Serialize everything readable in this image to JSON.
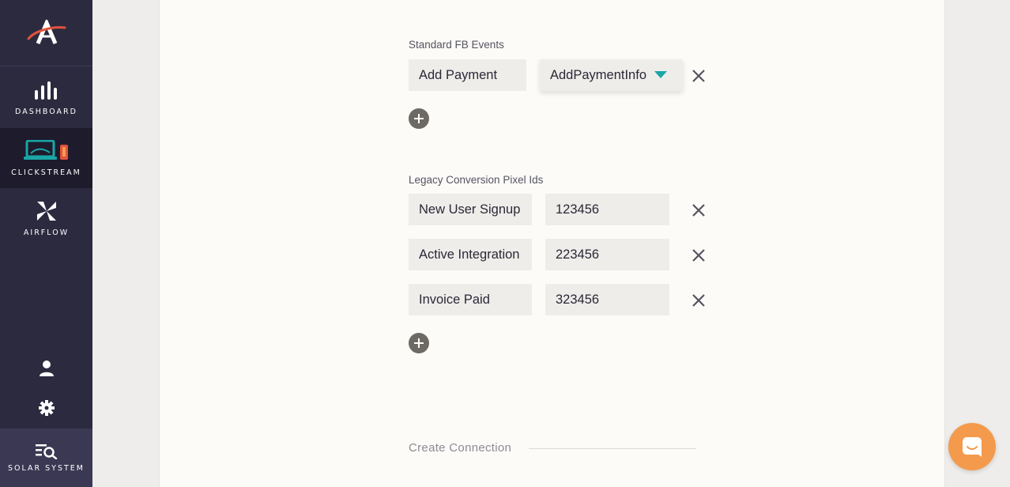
{
  "sidebar": {
    "logo_icon": "aerospace-logo-icon",
    "items": [
      {
        "label": "DASHBOARD",
        "icon": "bar-chart-icon"
      },
      {
        "label": "CLICKSTREAM",
        "icon": "laptop-phone-icon"
      },
      {
        "label": "AIRFLOW",
        "icon": "airflow-pinwheel-icon"
      }
    ],
    "user_icon": "user-icon",
    "settings_icon": "gear-icon",
    "footer": {
      "label": "SOLAR SYSTEM",
      "icon": "search-list-icon"
    }
  },
  "standard_fb_events": {
    "label": "Standard FB Events",
    "rows": [
      {
        "name": "Add Payment",
        "event": "AddPaymentInfo"
      }
    ]
  },
  "legacy_pixels": {
    "label": "Legacy Conversion Pixel Ids",
    "rows": [
      {
        "name": "New User Signup",
        "pixel_id": "123456"
      },
      {
        "name": "Active Integration",
        "pixel_id": "223456"
      },
      {
        "name": "Invoice Paid",
        "pixel_id": "323456"
      }
    ]
  },
  "create_connection": {
    "label": "Create Connection"
  },
  "colors": {
    "sidebar": "#2c2a3f",
    "sidebar_active": "#1d1b2c",
    "accent_teal": "#1aa6a6",
    "accent_orange": "#f49a4c",
    "logo_red": "#e2533d"
  }
}
